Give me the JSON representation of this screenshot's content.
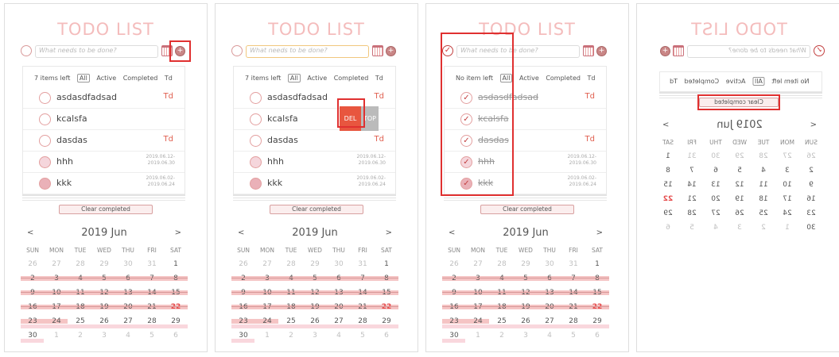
{
  "app": {
    "title": "TODO LIST",
    "placeholder": "What needs to be done?",
    "add_symbol": "+"
  },
  "filters": {
    "count_all": "7 items left",
    "count_none": "No item left",
    "all": "All",
    "active": "Active",
    "completed": "Completed",
    "td": "Td"
  },
  "todos": [
    {
      "text": "asdasdfadsad",
      "tag": "Td",
      "date1": "",
      "date2": ""
    },
    {
      "text": "kcalsfa",
      "tag": "",
      "date1": "",
      "date2": ""
    },
    {
      "text": "dasdas",
      "tag": "Td",
      "date1": "",
      "date2": ""
    },
    {
      "text": "hhh",
      "tag": "",
      "date1": "2019.06.12-",
      "date2": "2019.06.30"
    },
    {
      "text": "kkk",
      "tag": "",
      "date1": "2019.06.02-",
      "date2": "2019.06.24"
    }
  ],
  "actions": {
    "del": "DEL",
    "top": "TOP",
    "clear": "Clear completed"
  },
  "calendar": {
    "title": "2019 Jun",
    "prev": "<",
    "next": ">",
    "weekdays": [
      "SUN",
      "MON",
      "TUE",
      "WED",
      "THU",
      "FRI",
      "SAT"
    ],
    "weeks": [
      [
        "26",
        "27",
        "28",
        "29",
        "30",
        "31",
        "1"
      ],
      [
        "2",
        "3",
        "4",
        "5",
        "6",
        "7",
        "8"
      ],
      [
        "9",
        "10",
        "11",
        "12",
        "13",
        "14",
        "15"
      ],
      [
        "16",
        "17",
        "18",
        "19",
        "20",
        "21",
        "22"
      ],
      [
        "23",
        "24",
        "25",
        "26",
        "27",
        "28",
        "29"
      ],
      [
        "30",
        "1",
        "2",
        "3",
        "4",
        "5",
        "6"
      ]
    ]
  },
  "colors": {
    "accent": "#f4bcbc",
    "highlight": "#e03030",
    "del": "#e8563f"
  }
}
